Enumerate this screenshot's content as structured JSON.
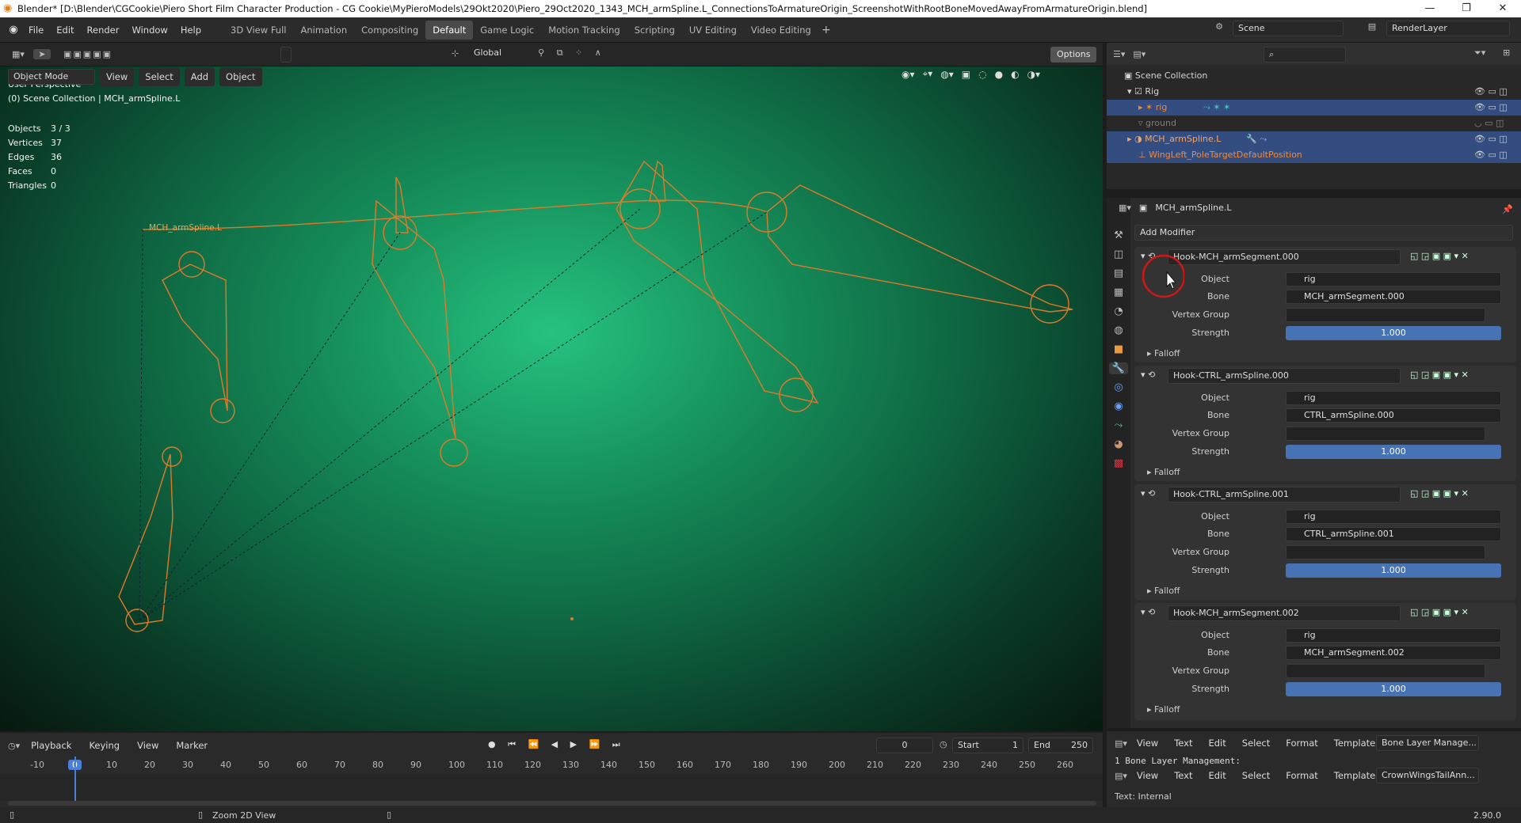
{
  "titlebar": {
    "title": "Blender* [D:\\Blender\\CGCookie\\Piero Short Film Character Production - CG Cookie\\MyPieroModels\\29Okt2020\\Piero_29Oct2020_1343_MCH_armSpline.L_ConnectionsToArmatureOrigin_ScreenshotWithRootBoneMovedAwayFromArmatureOrigin.blend]",
    "minimize": "—",
    "maximize": "❐",
    "close": "✕"
  },
  "menus": [
    "File",
    "Edit",
    "Render",
    "Window",
    "Help"
  ],
  "workspaces": [
    "3D View Full",
    "Animation",
    "Compositing",
    "Default",
    "Game Logic",
    "Motion Tracking",
    "Scripting",
    "UV Editing",
    "Video Editing"
  ],
  "active_workspace": "Default",
  "scene": {
    "label": "Scene",
    "renderlayer": "RenderLayer"
  },
  "viewport_header": {
    "mode": "Object Mode",
    "menus": [
      "View",
      "Select",
      "Add",
      "Object"
    ],
    "orientation": "Global",
    "options": "Options"
  },
  "viewport_overlay": {
    "perspective": "User Perspective",
    "collection": "(0) Scene Collection | MCH_armSpline.L",
    "stats": [
      {
        "label": "Objects",
        "value": "3 / 3"
      },
      {
        "label": "Vertices",
        "value": "37"
      },
      {
        "label": "Edges",
        "value": "36"
      },
      {
        "label": "Faces",
        "value": "0"
      },
      {
        "label": "Triangles",
        "value": "0"
      }
    ],
    "object_label": "MCH_armSpline.L"
  },
  "outliner": {
    "root": "Scene Collection",
    "items": [
      {
        "name": "Rig",
        "color": "#d0d0d0",
        "selected": false
      },
      {
        "name": "rig",
        "color": "#f08a3c",
        "selected": true
      },
      {
        "name": "ground",
        "color": "#7e7e7e",
        "selected": false
      },
      {
        "name": "MCH_armSpline.L",
        "color": "#f3a36a",
        "selected": true
      },
      {
        "name": "WingLeft_PoleTargetDefaultPosition",
        "color": "#f08a3c",
        "selected": true
      }
    ]
  },
  "properties": {
    "object_name": "MCH_armSpline.L",
    "add_modifier": "Add Modifier",
    "labels": {
      "object": "Object",
      "bone": "Bone",
      "vgroup": "Vertex Group",
      "strength": "Strength",
      "falloff": "Falloff"
    },
    "modifiers": [
      {
        "name": "Hook-MCH_armSegment.000",
        "object": "rig",
        "bone": "MCH_armSegment.000",
        "strength": "1.000"
      },
      {
        "name": "Hook-CTRL_armSpline.000",
        "object": "rig",
        "bone": "CTRL_armSpline.000",
        "strength": "1.000"
      },
      {
        "name": "Hook-CTRL_armSpline.001",
        "object": "rig",
        "bone": "CTRL_armSpline.001",
        "strength": "1.000"
      },
      {
        "name": "Hook-MCH_armSegment.002",
        "object": "rig",
        "bone": "MCH_armSegment.002",
        "strength": "1.000"
      }
    ]
  },
  "timeline": {
    "menus": [
      "Playback",
      "Keying",
      "View",
      "Marker"
    ],
    "current_frame": "0",
    "start_label": "Start",
    "start": "1",
    "end_label": "End",
    "end": "250",
    "ticks": [
      "-10",
      "0",
      "10",
      "20",
      "30",
      "40",
      "50",
      "60",
      "70",
      "80",
      "90",
      "100",
      "110",
      "120",
      "130",
      "140",
      "150",
      "160",
      "170",
      "180",
      "190",
      "200",
      "210",
      "220",
      "230",
      "240",
      "250",
      "260"
    ]
  },
  "text_editor": {
    "menus": [
      "View",
      "Text",
      "Edit",
      "Select",
      "Format",
      "Templates"
    ],
    "file1": "Bone Layer Manage...",
    "line1": "1  Bone Layer Management:",
    "file2": "CrownWingsTailAnn...",
    "internal": "Text: Internal"
  },
  "statusbar": {
    "left": "Zoom 2D View",
    "version": "2.90.0"
  }
}
